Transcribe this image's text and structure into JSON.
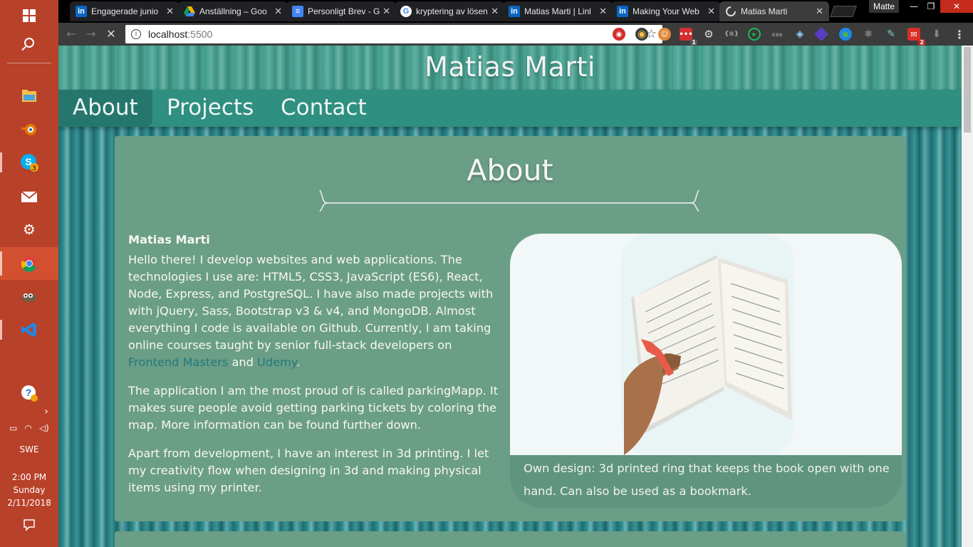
{
  "taskbar": {
    "icons": [
      "windows-start",
      "search",
      "file-explorer",
      "blender",
      "skype",
      "mail",
      "settings",
      "chrome",
      "gimp",
      "vscode",
      "help"
    ],
    "skype_badge": "3",
    "language": "SWE",
    "time": "2:00 PM",
    "day": "Sunday",
    "date": "2/11/2018"
  },
  "browser": {
    "tabs": [
      {
        "title": "Engagerade junio",
        "favicon": "linkedin"
      },
      {
        "title": "Anställning – Goo",
        "favicon": "google-drive"
      },
      {
        "title": "Personligt Brev - G",
        "favicon": "google-docs"
      },
      {
        "title": "kryptering av lösen",
        "favicon": "google"
      },
      {
        "title": "Matias Marti | Linl",
        "favicon": "linkedin"
      },
      {
        "title": "Making Your Web",
        "favicon": "linkedin"
      },
      {
        "title": "Matias Marti",
        "favicon": "loading"
      }
    ],
    "profile_name": "Matte",
    "url_host": "localhost",
    "url_port": ":5500",
    "ext_badges": {
      "ext1": "1",
      "gmail": "2"
    }
  },
  "page": {
    "site_title": "Matias Marti",
    "nav": [
      "About",
      "Projects",
      "Contact"
    ],
    "section_title": "About",
    "name": "Matias Marti",
    "p1_a": "Hello there! I develop websites and web applications. The technologies I use are: HTML5, CSS3, JavaScript (ES6), React, Node, Express, and PostgreSQL. I have also made projects with with jQuery, Sass, Bootstrap v3 & v4, and MongoDB. Almost everything I code is available on Github. Currently, I am taking online courses taught by senior full-stack developers on ",
    "link_frontend": "Frontend Masters",
    "p1_and": " and ",
    "link_udemy": "Udemy",
    "p1_end": ".",
    "p2": "The application I am the most proud of is called parkingMapp. It makes sure people avoid getting parking tickets by coloring the map. More information can be found further down.",
    "p3": "Apart from development, I have an interest in 3d printing. I let my creativity flow when designing in 3d and making physical items using my printer.",
    "caption": "Own design: 3d printed ring that keeps the book open with one hand. Can also be used as a bookmark."
  }
}
